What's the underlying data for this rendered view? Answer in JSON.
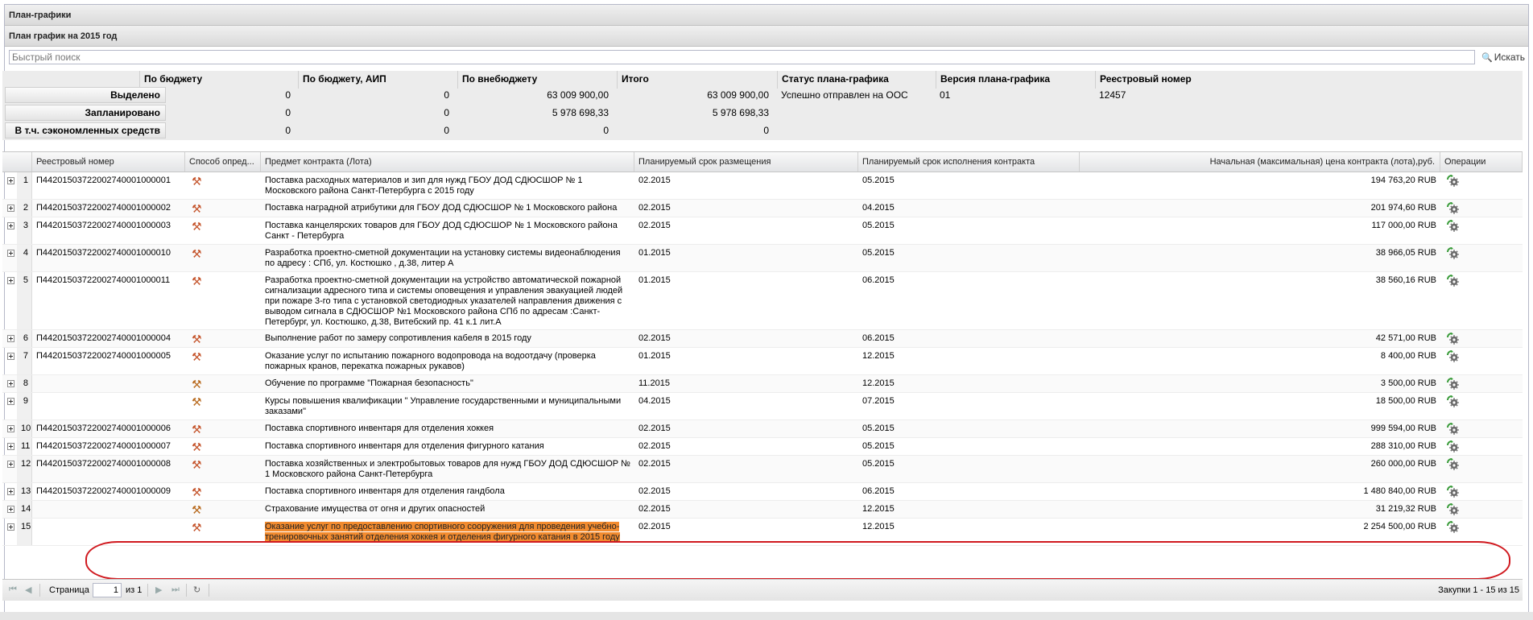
{
  "panel": {
    "title": "План-графики",
    "subtitle": "План график на 2015 год"
  },
  "search": {
    "placeholder": "Быстрый поиск",
    "button_label": "Искать"
  },
  "summary": {
    "columns": [
      "По бюджету",
      "По бюджету, АИП",
      "По внебюджету",
      "Итого",
      "Статус плана-графика",
      "Версия плана-графика",
      "Реестровый номер"
    ],
    "rows": [
      {
        "label": "Выделено",
        "values": [
          "0",
          "0",
          "63 009 900,00",
          "63 009 900,00",
          "Успешно отправлен на ООС",
          "01",
          "12457"
        ]
      },
      {
        "label": "Запланировано",
        "values": [
          "0",
          "0",
          "5 978 698,33",
          "5 978 698,33",
          "",
          "",
          ""
        ]
      },
      {
        "label": "В т.ч. сэкономленных средств",
        "values": [
          "0",
          "0",
          "0",
          "0",
          "",
          "",
          ""
        ]
      }
    ]
  },
  "grid": {
    "headers": [
      "Реестровый номер",
      "Способ опред...",
      "Предмет контракта (Лота)",
      "Планируемый срок размещения",
      "Планируемый срок исполнения контракта",
      "Начальная (максимальная) цена контракта (лота),руб.",
      "Операции"
    ],
    "rows": [
      {
        "n": "1",
        "reg": "П44201503722002740001000001",
        "subject": "Поставка расходных материалов и зип для нужд ГБОУ ДОД СДЮСШОР № 1 Московского района Санкт-Петербурга с 2015 году",
        "place": "02.2015",
        "exec": "05.2015",
        "price": "194 763,20 RUB"
      },
      {
        "n": "2",
        "reg": "П44201503722002740001000002",
        "subject": "Поставка наградной атрибутики для ГБОУ ДОД СДЮСШОР № 1 Московского района",
        "place": "02.2015",
        "exec": "04.2015",
        "price": "201 974,60 RUB"
      },
      {
        "n": "3",
        "reg": "П44201503722002740001000003",
        "subject": "Поставка канцелярских товаров для ГБОУ ДОД СДЮСШОР № 1 Московского района Санкт - Петербурга",
        "place": "02.2015",
        "exec": "05.2015",
        "price": "117 000,00 RUB"
      },
      {
        "n": "4",
        "reg": "П44201503722002740001000010",
        "subject": "Разработка проектно-сметной документации на установку системы видеонаблюдения по адресу : СПб, ул. Костюшко , д.38, литер А",
        "place": "01.2015",
        "exec": "05.2015",
        "price": "38 966,05 RUB"
      },
      {
        "n": "5",
        "reg": "П44201503722002740001000011",
        "subject": "Разработка проектно-сметной документации на устройство автоматической пожарной сигнализации адресного типа и системы оповещения и управления эвакуацией людей при пожаре 3-го типа с установкой светодиодных указателей направления движения с выводом сигнала в СДЮСШОР №1 Московского района СПб по адресам :Санкт-Петербург, ул. Костюшко, д.38, Витебский пр. 41 к.1 лит.А",
        "place": "01.2015",
        "exec": "06.2015",
        "price": "38 560,16 RUB"
      },
      {
        "n": "6",
        "reg": "П44201503722002740001000004",
        "subject": "Выполнение работ по замеру сопротивления кабеля в 2015 году",
        "place": "02.2015",
        "exec": "06.2015",
        "price": "42 571,00 RUB"
      },
      {
        "n": "7",
        "reg": "П44201503722002740001000005",
        "subject": "Оказание услуг по испытанию пожарного водопровода на водоотдачу (проверка пожарных кранов, перекатка пожарных рукавов)",
        "place": "01.2015",
        "exec": "12.2015",
        "price": "8 400,00 RUB"
      },
      {
        "n": "8",
        "reg": "",
        "subject": "Обучение по программе \"Пожарная безопасность\"",
        "place": "11.2015",
        "exec": "12.2015",
        "price": "3 500,00 RUB"
      },
      {
        "n": "9",
        "reg": "",
        "subject": "Курсы повышения квалификации \" Управление государственными и муниципальными заказами\"",
        "place": "04.2015",
        "exec": "07.2015",
        "price": "18 500,00 RUB"
      },
      {
        "n": "10",
        "reg": "П44201503722002740001000006",
        "subject": "Поставка спортивного инвентаря для отделения хоккея",
        "place": "02.2015",
        "exec": "05.2015",
        "price": "999 594,00 RUB"
      },
      {
        "n": "11",
        "reg": "П44201503722002740001000007",
        "subject": "Поставка спортивного инвентаря для отделения фигурного катания",
        "place": "02.2015",
        "exec": "05.2015",
        "price": "288 310,00 RUB"
      },
      {
        "n": "12",
        "reg": "П44201503722002740001000008",
        "subject": "Поставка хозяйственных и электробытовых товаров для нужд ГБОУ ДОД СДЮСШОР № 1 Московского района Санкт-Петербурга",
        "place": "02.2015",
        "exec": "05.2015",
        "price": "260 000,00 RUB"
      },
      {
        "n": "13",
        "reg": "П44201503722002740001000009",
        "subject": "Поставка спортивного инвентаря для отделения гандбола",
        "place": "02.2015",
        "exec": "06.2015",
        "price": "1 480 840,00 RUB"
      },
      {
        "n": "14",
        "reg": "",
        "subject": "Страхование имущества от огня и других опасностей",
        "place": "02.2015",
        "exec": "12.2015",
        "price": "31 219,32 RUB"
      },
      {
        "n": "15",
        "reg": "",
        "subject": "Оказание услуг по предоставлению спортивного сооружения для проведения учебно-тренировочных занятий отделения хоккея и отделения фигурного катания в 2015 году",
        "place": "02.2015",
        "exec": "12.2015",
        "price": "2 254 500,00 RUB"
      }
    ]
  },
  "pager": {
    "page_label": "Страница",
    "page_value": "1",
    "of_label": "из 1",
    "info": "Закупки 1 - 15 из 15"
  },
  "colors": {
    "highlight": "#f28b2f",
    "annotation": "#d0191f",
    "method_icon": "#c4532a"
  },
  "icons": {
    "method": "hammer-icon",
    "operation": "gear-refresh-icon",
    "expand": "plus-square-icon"
  }
}
